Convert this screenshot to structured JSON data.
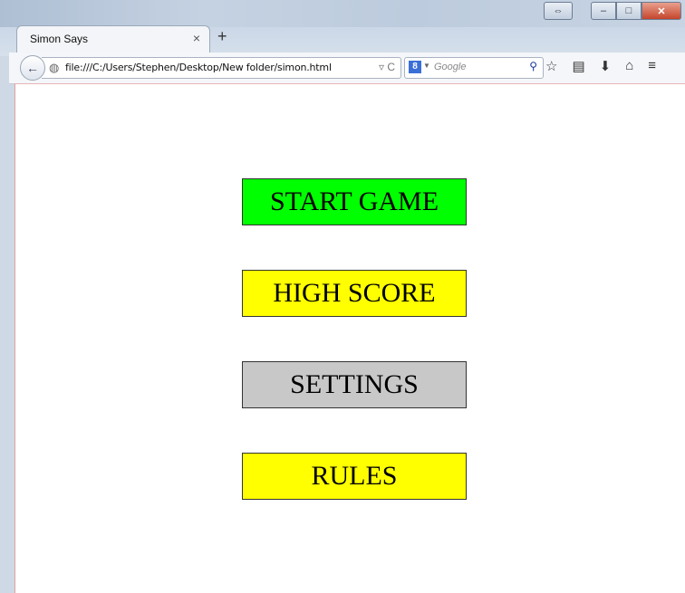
{
  "window": {
    "controls": {
      "restore": "⇔",
      "minimize": "–",
      "maximize": "□",
      "close": "✕"
    }
  },
  "tab": {
    "title": "Simon Says",
    "close": "×",
    "new_tab": "+"
  },
  "nav": {
    "back": "←",
    "url": "file:///C:/Users/Stephen/Desktop/New folder/simon.html",
    "url_icons": "▿ C",
    "search_engine_badge": "8",
    "search_placeholder": "Google",
    "toolbar_icons": [
      "☆",
      "▤",
      "⬇",
      "⌂",
      "≡"
    ]
  },
  "menu": {
    "buttons": [
      {
        "label": "START GAME",
        "color": "#00ff00"
      },
      {
        "label": "HIGH SCORE",
        "color": "#ffff00"
      },
      {
        "label": "SETTINGS",
        "color": "#c8c8c8"
      },
      {
        "label": "RULES",
        "color": "#ffff00"
      }
    ]
  }
}
